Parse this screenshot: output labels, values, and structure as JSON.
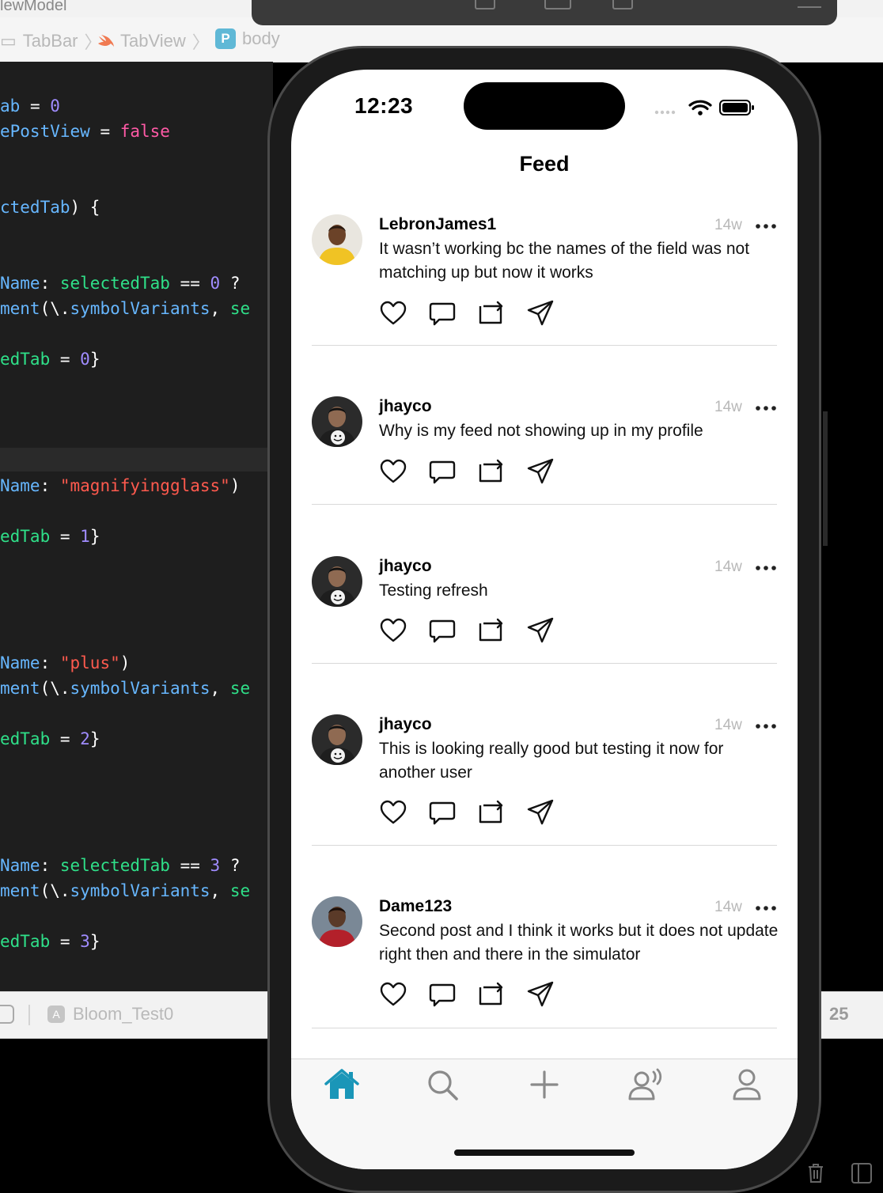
{
  "xcode": {
    "breadcrumbs": [
      "TabBar",
      "TabView",
      "body"
    ],
    "code_lines": [
      {
        "parts": [
          [
            "ab",
            "c-cyan"
          ],
          [
            " = ",
            "c-white"
          ],
          [
            "0",
            "c-num"
          ]
        ]
      },
      {
        "parts": [
          [
            "ePostView",
            "c-cyan"
          ],
          [
            " = ",
            "c-white"
          ],
          [
            "false",
            "c-pink"
          ]
        ]
      },
      {
        "parts": [
          [
            "ctedTab",
            "c-cyan"
          ],
          [
            ") {",
            "c-white"
          ]
        ]
      },
      {
        "parts": [
          [
            "Name",
            "c-cyan"
          ],
          [
            ": ",
            "c-white"
          ],
          [
            "selectedTab",
            "c-green"
          ],
          [
            " == ",
            "c-white"
          ],
          [
            "0",
            "c-num"
          ],
          [
            " ?",
            "c-white"
          ]
        ]
      },
      {
        "parts": [
          [
            "ment",
            "c-cyan"
          ],
          [
            "(\\.",
            "c-white"
          ],
          [
            "symbolVariants",
            "c-cyan"
          ],
          [
            ", ",
            "c-white"
          ],
          [
            "se",
            "c-green"
          ]
        ]
      },
      {
        "parts": [
          [
            "edTab",
            "c-green"
          ],
          [
            " = ",
            "c-white"
          ],
          [
            "0",
            "c-num"
          ],
          [
            "}",
            "c-white"
          ]
        ]
      },
      {
        "parts": [
          [
            "Name",
            "c-cyan"
          ],
          [
            ": ",
            "c-white"
          ],
          [
            "\"magnifyingglass\"",
            "c-red"
          ],
          [
            ")",
            "c-white"
          ]
        ]
      },
      {
        "parts": [
          [
            "edTab",
            "c-green"
          ],
          [
            " = ",
            "c-white"
          ],
          [
            "1",
            "c-num"
          ],
          [
            "}",
            "c-white"
          ]
        ]
      },
      {
        "parts": [
          [
            "Name",
            "c-cyan"
          ],
          [
            ": ",
            "c-white"
          ],
          [
            "\"plus\"",
            "c-red"
          ],
          [
            ")",
            "c-white"
          ]
        ]
      },
      {
        "parts": [
          [
            "ment",
            "c-cyan"
          ],
          [
            "(\\.",
            "c-white"
          ],
          [
            "symbolVariants",
            "c-cyan"
          ],
          [
            ", ",
            "c-white"
          ],
          [
            "se",
            "c-green"
          ]
        ]
      },
      {
        "parts": [
          [
            "edTab",
            "c-green"
          ],
          [
            " = ",
            "c-white"
          ],
          [
            "2",
            "c-num"
          ],
          [
            "}",
            "c-white"
          ]
        ]
      },
      {
        "parts": [
          [
            "Name",
            "c-cyan"
          ],
          [
            ": ",
            "c-white"
          ],
          [
            "selectedTab",
            "c-green"
          ],
          [
            " == ",
            "c-white"
          ],
          [
            "3",
            "c-num"
          ],
          [
            " ?",
            "c-white"
          ]
        ]
      },
      {
        "parts": [
          [
            "ment",
            "c-cyan"
          ],
          [
            "(\\.",
            "c-white"
          ],
          [
            "symbolVariants",
            "c-cyan"
          ],
          [
            ", ",
            "c-white"
          ],
          [
            "se",
            "c-green"
          ]
        ]
      },
      {
        "parts": [
          [
            "edTab",
            "c-green"
          ],
          [
            " = ",
            "c-white"
          ],
          [
            "3",
            "c-num"
          ],
          [
            "}",
            "c-white"
          ]
        ]
      }
    ],
    "scheme_name": "Bloom_Test0",
    "line_number": "25"
  },
  "phone": {
    "status_time": "12:23",
    "nav_title": "Feed",
    "posts": [
      {
        "username": "LebronJames1",
        "time": "14w",
        "text": "It wasn’t working bc the names of the field was not matching up but now it works"
      },
      {
        "username": "jhayco",
        "time": "14w",
        "text": "Why is my feed not showing up in my profile"
      },
      {
        "username": "jhayco",
        "time": "14w",
        "text": "Testing refresh"
      },
      {
        "username": "jhayco",
        "time": "14w",
        "text": "This is looking really good but testing it now for another user"
      },
      {
        "username": "Dame123",
        "time": "14w",
        "text": "Second post and I think it works but it does not update right then and there in the simulator"
      }
    ],
    "tabs": [
      "home-icon",
      "search-icon",
      "plus-icon",
      "activity-icon",
      "profile-icon"
    ],
    "selected_tab": 0,
    "accent_color": "#1a96b8"
  }
}
